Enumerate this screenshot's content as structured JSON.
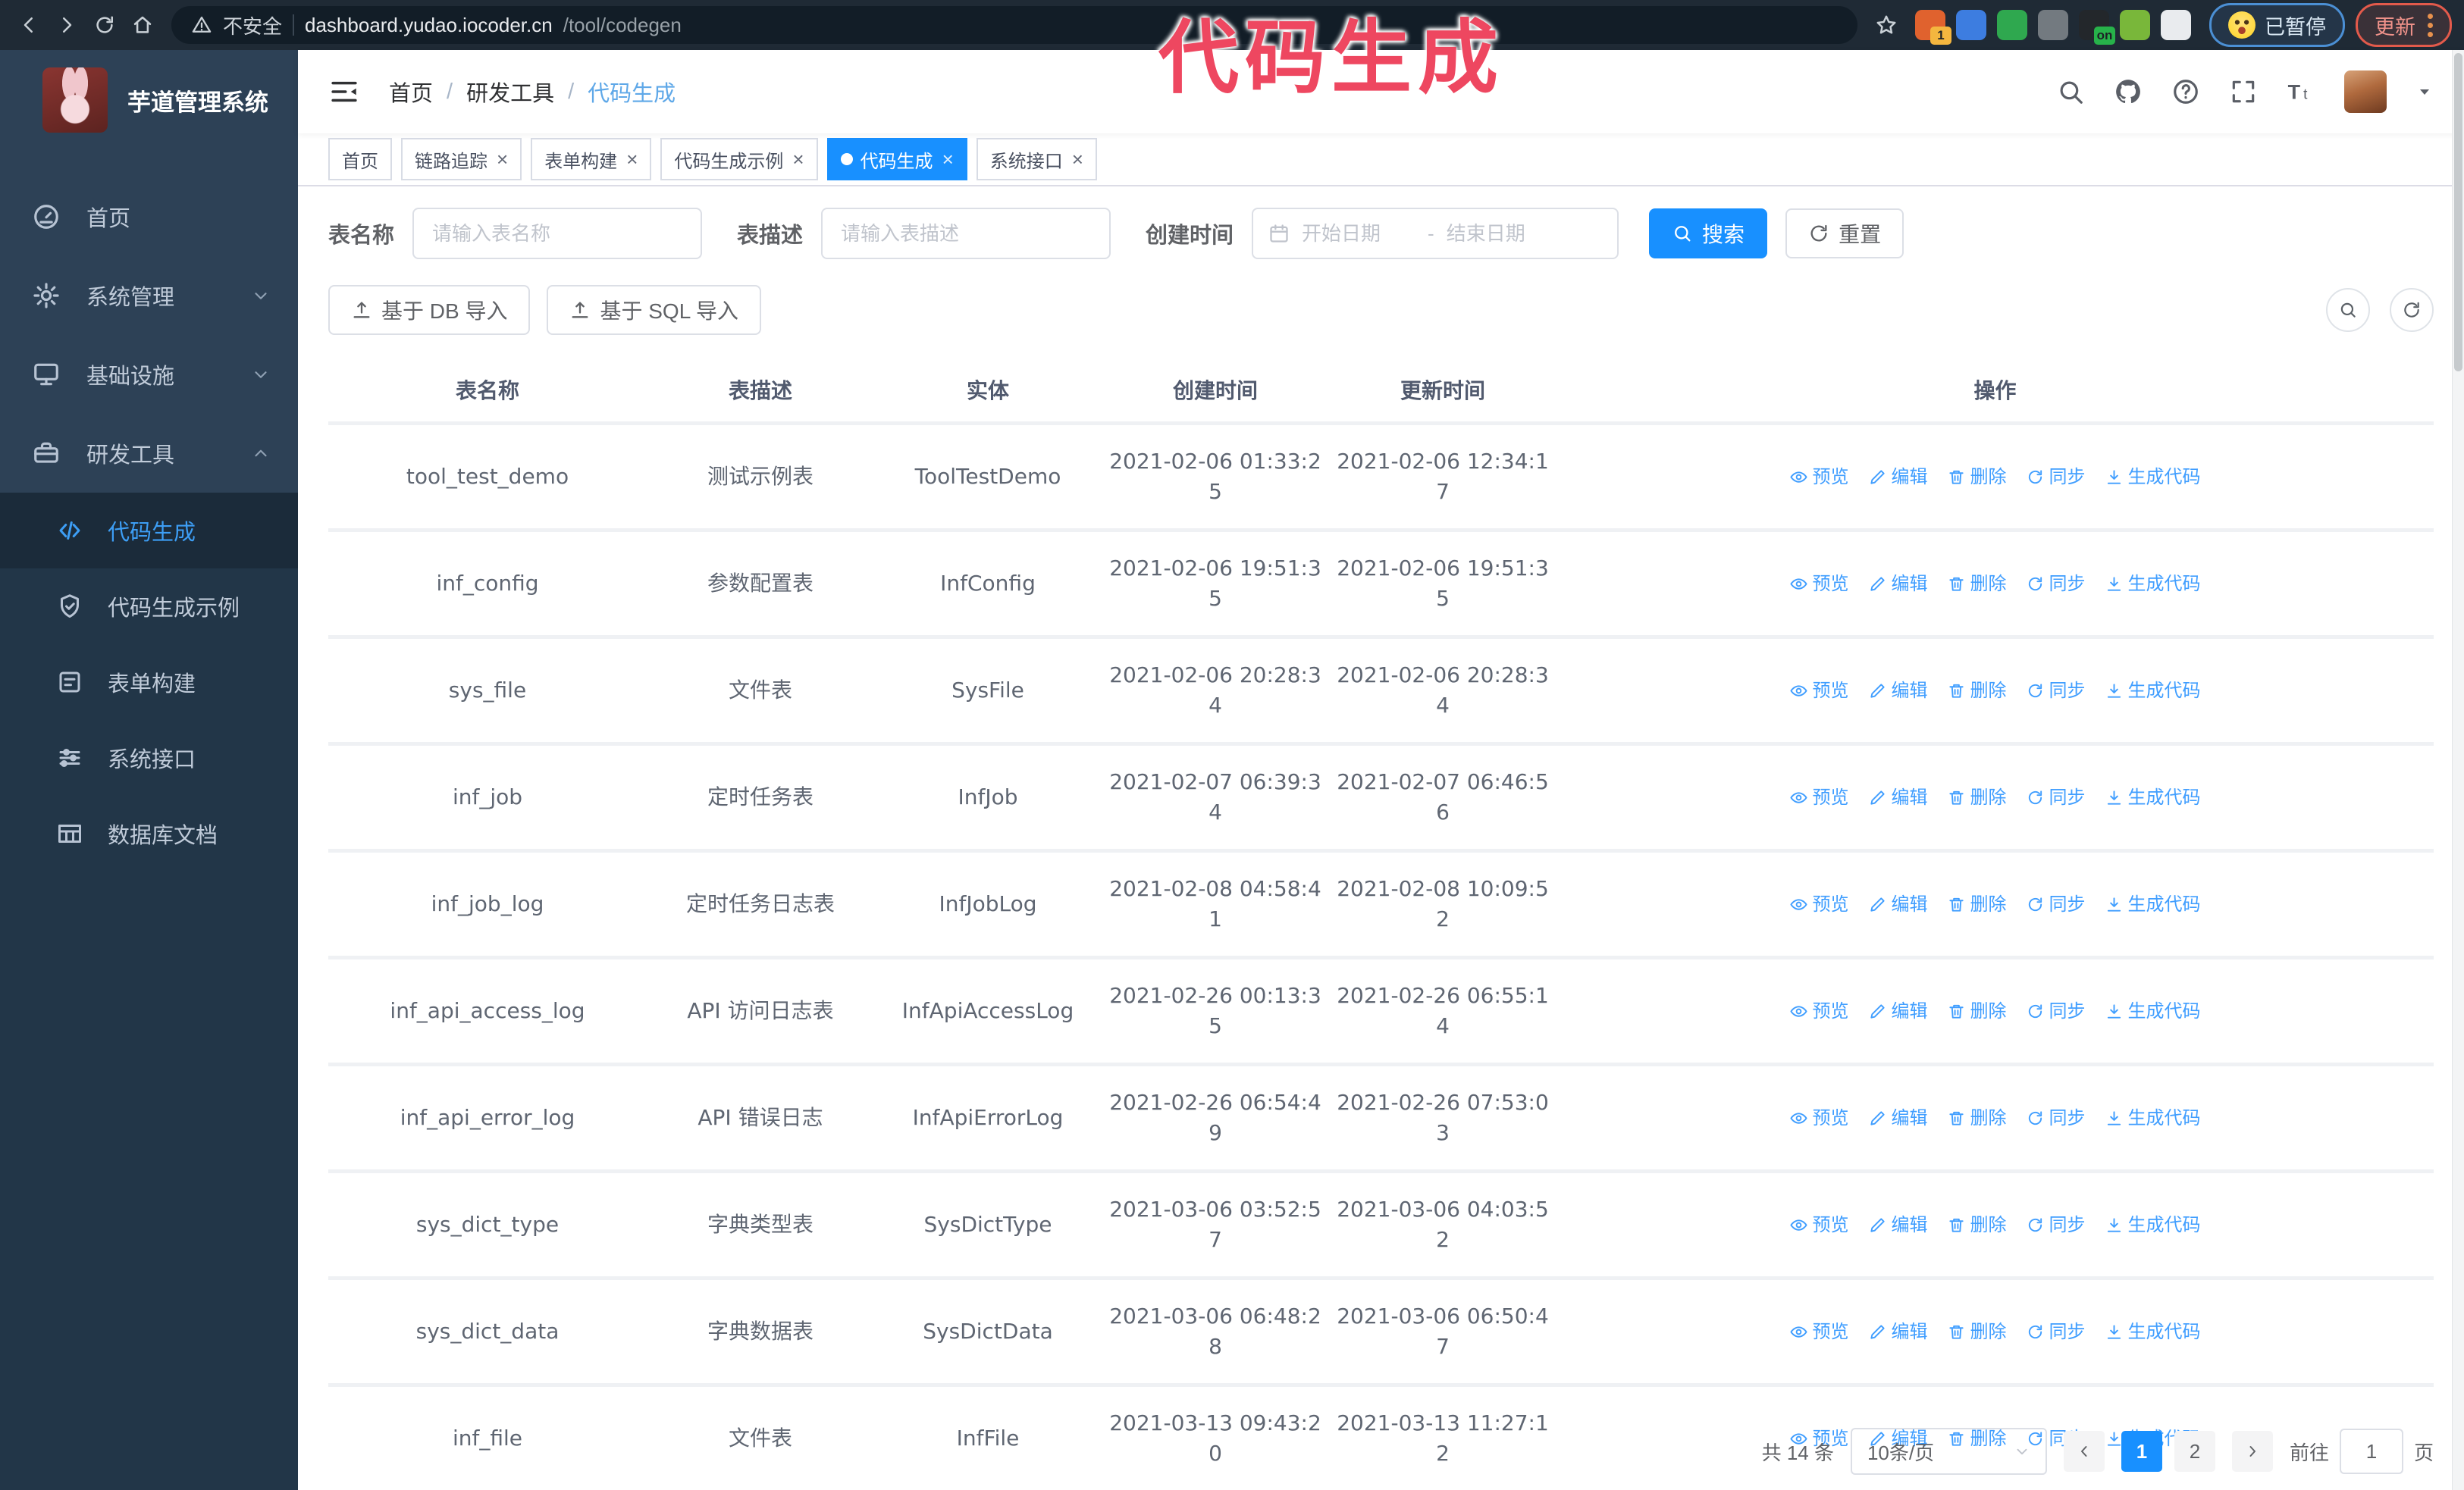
{
  "colors": {
    "accent_strong": "#1890ff",
    "link": "#409eff",
    "annotation_pink": "#ee4760",
    "sidebar_bg": "#2d4156",
    "sidebar_submenu_bg": "#223648",
    "chrome_bg": "#1f2a35"
  },
  "browser": {
    "security_label": "不安全",
    "url_host": "dashboard.yudao.iocoder.cn",
    "url_path": "/tool/codegen",
    "paused_label": "已暂停",
    "update_label": "更新",
    "extensions": [
      {
        "name": "orange-extension-icon",
        "color": "#e0622e",
        "badge": "1",
        "badge_color": "#f4b63f"
      },
      {
        "name": "blue-gem-extension-icon",
        "color": "#3d7de0",
        "badge": "",
        "badge_color": ""
      },
      {
        "name": "green-check-extension-icon",
        "color": "#2fa84f",
        "badge": "",
        "badge_color": ""
      },
      {
        "name": "tabs-grid-extension-icon",
        "color": "#737a80",
        "badge": "",
        "badge_color": ""
      },
      {
        "name": "dark-extension-icon",
        "color": "#23272b",
        "badge": "on",
        "badge_color": "#27b24a"
      },
      {
        "name": "green-robot-extension-icon",
        "color": "#79b73a",
        "badge": "",
        "badge_color": ""
      },
      {
        "name": "puzzle-extension-icon",
        "color": "#e9ebee",
        "badge": "",
        "badge_color": ""
      }
    ]
  },
  "annotation": {
    "text": "代码生成"
  },
  "sidebar": {
    "app_title": "芋道管理系统",
    "items": [
      {
        "label": "首页",
        "icon": "dashboard",
        "chevron": ""
      },
      {
        "label": "系统管理",
        "icon": "gear",
        "chevron": "down"
      },
      {
        "label": "基础设施",
        "icon": "monitor",
        "chevron": "down"
      },
      {
        "label": "研发工具",
        "icon": "toolbox",
        "chevron": "up"
      }
    ],
    "subitems": [
      {
        "label": "代码生成",
        "icon": "code",
        "active": true
      },
      {
        "label": "代码生成示例",
        "icon": "shield",
        "active": false
      },
      {
        "label": "表单构建",
        "icon": "form",
        "active": false
      },
      {
        "label": "系统接口",
        "icon": "sliders",
        "active": false
      },
      {
        "label": "数据库文档",
        "icon": "dbtable",
        "active": false
      }
    ]
  },
  "navbar": {
    "separator": "/",
    "breadcrumb": [
      {
        "label": "首页",
        "current": false
      },
      {
        "label": "研发工具",
        "current": false
      },
      {
        "label": "代码生成",
        "current": true
      }
    ]
  },
  "tabs_meta": {
    "close_glyph": "×"
  },
  "tabs": [
    {
      "label": "首页",
      "closable": false,
      "active": false
    },
    {
      "label": "链路追踪",
      "closable": true,
      "active": false
    },
    {
      "label": "表单构建",
      "closable": true,
      "active": false
    },
    {
      "label": "代码生成示例",
      "closable": true,
      "active": false
    },
    {
      "label": "代码生成",
      "closable": true,
      "active": true
    },
    {
      "label": "系统接口",
      "closable": true,
      "active": false
    }
  ],
  "filters": {
    "table_name_label": "表名称",
    "table_name_placeholder": "请输入表名称",
    "table_desc_label": "表描述",
    "table_desc_placeholder": "请输入表描述",
    "create_time_label": "创建时间",
    "date_start_placeholder": "开始日期",
    "date_separator": "-",
    "date_end_placeholder": "结束日期",
    "search_label": "搜索",
    "reset_label": "重置"
  },
  "toolbar": {
    "import_db_label": "基于 DB 导入",
    "import_sql_label": "基于 SQL 导入"
  },
  "table": {
    "columns": [
      "表名称",
      "表描述",
      "实体",
      "创建时间",
      "更新时间",
      "操作"
    ],
    "actions": [
      "预览",
      "编辑",
      "删除",
      "同步",
      "生成代码"
    ],
    "rows": [
      {
        "name": "tool_test_demo",
        "desc": "测试示例表",
        "entity": "ToolTestDemo",
        "created": "2021-02-06 01:33:25",
        "updated": "2021-02-06 12:34:17"
      },
      {
        "name": "inf_config",
        "desc": "参数配置表",
        "entity": "InfConfig",
        "created": "2021-02-06 19:51:35",
        "updated": "2021-02-06 19:51:35"
      },
      {
        "name": "sys_file",
        "desc": "文件表",
        "entity": "SysFile",
        "created": "2021-02-06 20:28:34",
        "updated": "2021-02-06 20:28:34"
      },
      {
        "name": "inf_job",
        "desc": "定时任务表",
        "entity": "InfJob",
        "created": "2021-02-07 06:39:34",
        "updated": "2021-02-07 06:46:56"
      },
      {
        "name": "inf_job_log",
        "desc": "定时任务日志表",
        "entity": "InfJobLog",
        "created": "2021-02-08 04:58:41",
        "updated": "2021-02-08 10:09:52"
      },
      {
        "name": "inf_api_access_log",
        "desc": "API 访问日志表",
        "entity": "InfApiAccessLog",
        "created": "2021-02-26 00:13:35",
        "updated": "2021-02-26 06:55:14"
      },
      {
        "name": "inf_api_error_log",
        "desc": "API 错误日志",
        "entity": "InfApiErrorLog",
        "created": "2021-02-26 06:54:49",
        "updated": "2021-02-26 07:53:03"
      },
      {
        "name": "sys_dict_type",
        "desc": "字典类型表",
        "entity": "SysDictType",
        "created": "2021-03-06 03:52:57",
        "updated": "2021-03-06 04:03:52"
      },
      {
        "name": "sys_dict_data",
        "desc": "字典数据表",
        "entity": "SysDictData",
        "created": "2021-03-06 06:48:28",
        "updated": "2021-03-06 06:50:47"
      },
      {
        "name": "inf_file",
        "desc": "文件表",
        "entity": "InfFile",
        "created": "2021-03-13 09:43:20",
        "updated": "2021-03-13 11:27:12"
      }
    ]
  },
  "pagination": {
    "total_label": "共 14 条",
    "page_size_label": "10条/页",
    "pages": [
      "1",
      "2"
    ],
    "active_page": "1",
    "goto_label": "前往",
    "goto_value": "1",
    "goto_suffix": "页"
  }
}
